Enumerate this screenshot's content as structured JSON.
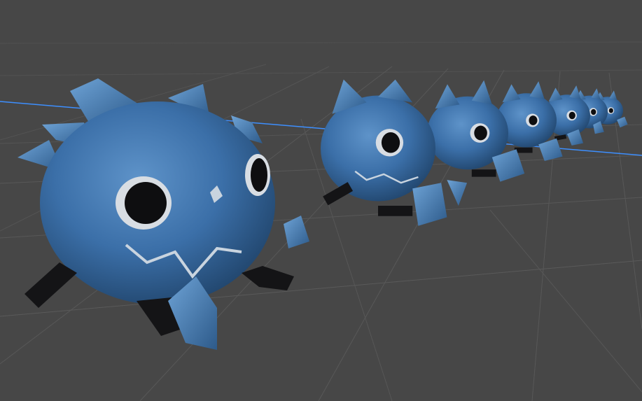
{
  "scene": {
    "background_color": "#474747",
    "grid_color": "#5c5c5c",
    "axis_color": "#3d8fff",
    "creature": {
      "body_color": "#3b6fa8",
      "body_shadow_color": "#22476f",
      "body_highlight_color": "#5e93c9",
      "eye_ring_color": "#d8dde3",
      "pupil_color": "#0e0e10",
      "mark_color": "#c9d4df",
      "leg_color": "#141416",
      "count": 7
    }
  }
}
